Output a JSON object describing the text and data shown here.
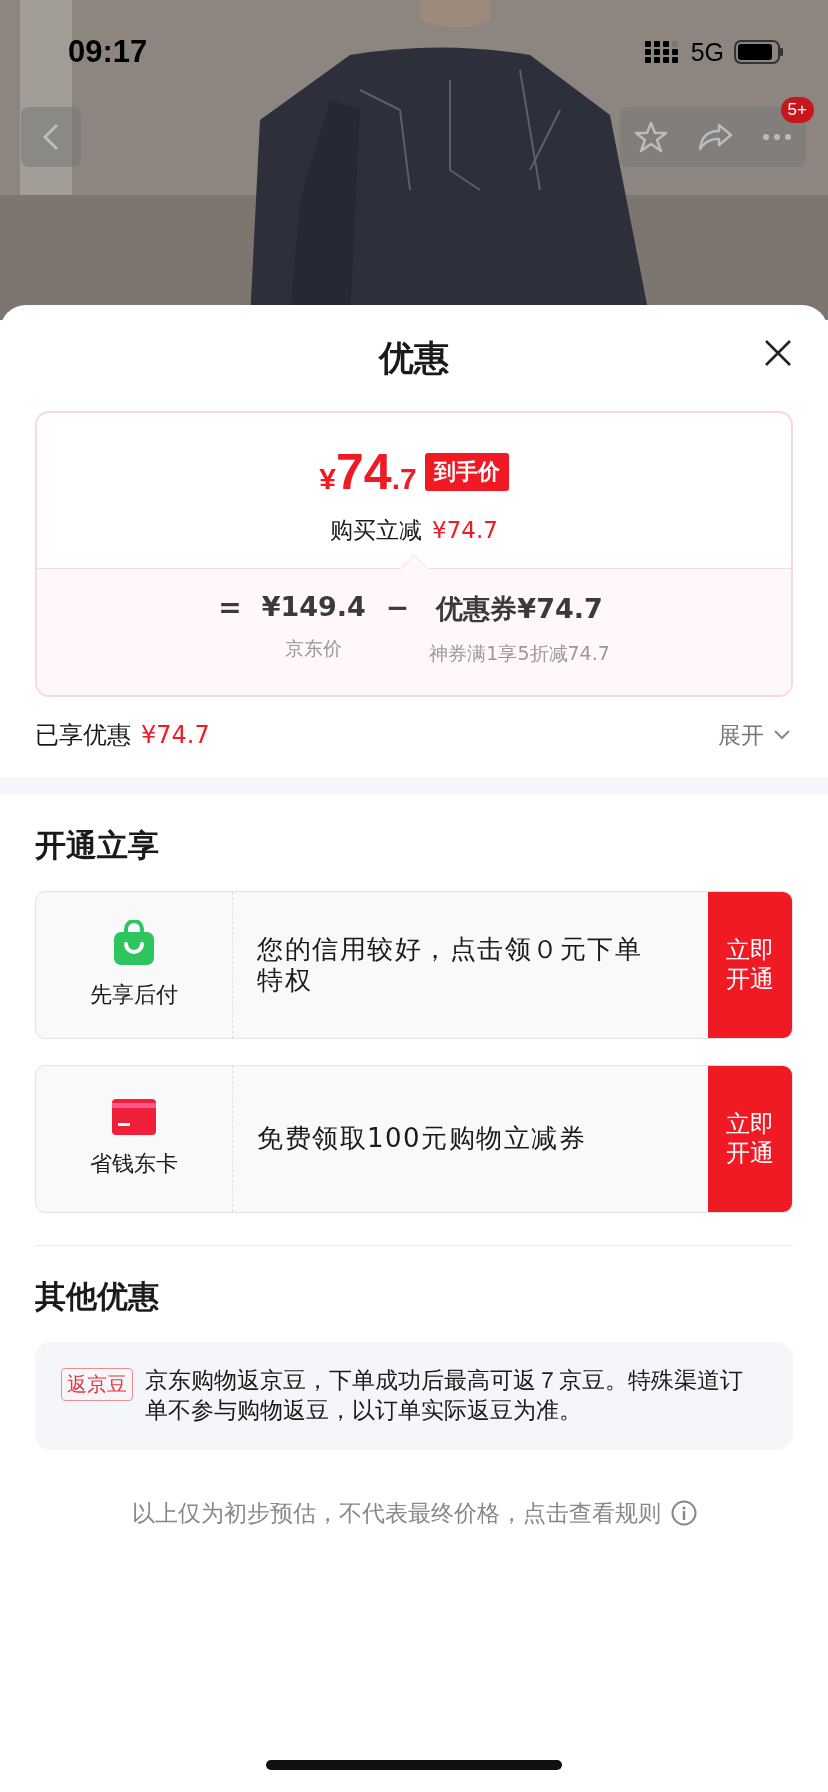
{
  "status_bar": {
    "time": "09:17",
    "network": "5G"
  },
  "nav": {
    "badge": "5+"
  },
  "sheet": {
    "title": "优惠"
  },
  "price_card": {
    "currency": "¥",
    "integer": "74",
    "decimal": ".7",
    "tag": "到手价",
    "reduction_label": "购买立减",
    "reduction_value": "¥74.7",
    "formula": [
      {
        "op": "=",
        "value": "¥149.4",
        "caption": "京东价"
      },
      {
        "op": "−",
        "label": "优惠券",
        "value": "¥74.7",
        "caption": "神券满1享5折减74.7"
      }
    ]
  },
  "enjoyed": {
    "label": "已享优惠",
    "value": "¥74.7",
    "toggle": "展开",
    "expanded": false
  },
  "open_section": {
    "title": "开通立享",
    "offers": [
      {
        "kind": "bag",
        "name": "先享后付",
        "text": "您的信用较好，点击领０元下单特权",
        "button": "立即开通"
      },
      {
        "kind": "card",
        "name": "省钱东卡",
        "text": "免费领取100元购物立减券",
        "button": "立即开通"
      }
    ]
  },
  "other_section": {
    "title": "其他优惠",
    "items": [
      {
        "tag": "返京豆",
        "text": "京东购物返京豆，下单成功后最高可返７京豆。特殊渠道订单不参与购物返豆，以订单实际返豆为准。"
      }
    ]
  },
  "footer": {
    "text": "以上仅为初步预估，不代表最终价格，点击查看规则"
  }
}
